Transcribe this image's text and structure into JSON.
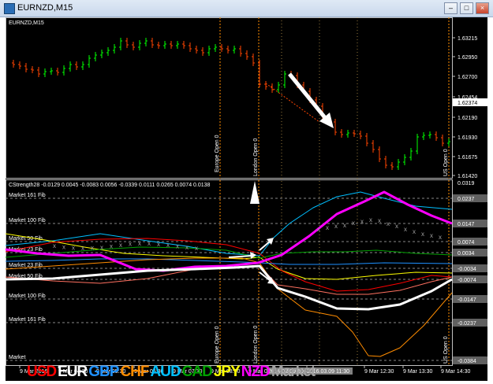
{
  "window": {
    "title": "EURNZD,M15"
  },
  "main_pane": {
    "label": "EURNZD,M15",
    "price_ticks": [
      "1.63215",
      "1.62950",
      "1.62700",
      "1.62454",
      "1.62190",
      "1.61930",
      "1.61675",
      "1.61420"
    ],
    "current_price": "1.62374",
    "sessions": [
      "Europe Open 0",
      "London Open 0",
      "US Open 0"
    ]
  },
  "indicator_pane": {
    "label": "CStrength28 -0.0129 0.0045 -0.0083 0.0056 -0.0339 0.0111 0.0265 0.0074 0.0138",
    "levels": [
      {
        "name": "Market 161 Fib",
        "value": "0.0237"
      },
      {
        "name": "Market 100 Fib",
        "value": "0.0147"
      },
      {
        "name": "Market 50 Fib",
        "value": "0.0074"
      },
      {
        "name": "Market 23 Fib",
        "value": "0.0034"
      },
      {
        "name": "Market 23 Fib",
        "value": "-0.0034"
      },
      {
        "name": "Market 50 Fib",
        "value": "-0.0074"
      },
      {
        "name": "Market 100 Fib",
        "value": "-0.0147"
      },
      {
        "name": "Market 161 Fib",
        "value": "-0.0237"
      },
      {
        "name": "Market",
        "value": "-0.0384"
      }
    ],
    "top_value": "0.0319",
    "sessions": [
      "Europe Open 0",
      "London Open 0",
      "US Open 0"
    ]
  },
  "currencies": [
    {
      "name": "USD",
      "color": "#ff0000"
    },
    {
      "name": "EUR",
      "color": "#ffffff"
    },
    {
      "name": "GBP",
      "color": "#1e90ff"
    },
    {
      "name": "CHF",
      "color": "#ff8c00"
    },
    {
      "name": "AUD",
      "color": "#00bfff"
    },
    {
      "name": "CAD",
      "color": "#00a000"
    },
    {
      "name": "JPY",
      "color": "#ffff00"
    },
    {
      "name": "NZD",
      "color": "#ff00ff"
    },
    {
      "name": "Market",
      "color": "#a0a0a0"
    }
  ],
  "time_axis": [
    "9 Mar 2016",
    "9 Mar 04:30",
    "9 Mar 05:30",
    "9 Mar 06:30",
    "9 Mar 07:30",
    "9 Mar 08:30",
    "9 Mar 09:30",
    "2016.03.09 10:30",
    "2016.03.09 11:30",
    "9 Mar 12:30",
    "9 Mar 13:30",
    "9 Mar 14:30"
  ],
  "colors": {
    "bull": "#00ff00",
    "bear": "#ff4500",
    "grid": "#c0c0c0",
    "session": "#ff8c00"
  }
}
